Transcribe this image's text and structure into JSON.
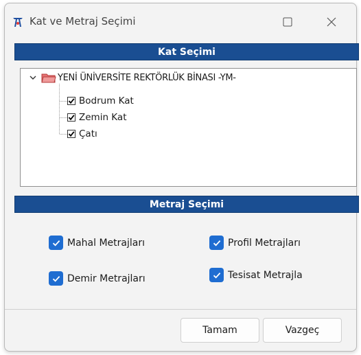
{
  "window": {
    "title": "Kat ve Metraj Seçimi",
    "app_icon": "app-logo-icon",
    "maximize_icon": "maximize-icon",
    "close_icon": "close-icon"
  },
  "kat_section": {
    "header": "Kat Seçimi",
    "tree": {
      "root": {
        "label": "YENİ ÜNİVERSİTE REKTÖRLÜK BİNASI -YM-",
        "expanded": true,
        "icon": "folder-icon"
      },
      "children": [
        {
          "label": "Bodrum Kat",
          "checked": true
        },
        {
          "label": "Zemin Kat",
          "checked": true
        },
        {
          "label": "Çatı",
          "checked": true
        }
      ]
    }
  },
  "metraj_section": {
    "header": "Metraj Seçimi",
    "options": [
      {
        "label": "Mahal Metrajları",
        "checked": true
      },
      {
        "label": "Profil Metrajları",
        "checked": true
      },
      {
        "label": "Demir Metrajları",
        "checked": true
      },
      {
        "label": "Tesisat Metrajla",
        "checked": true
      }
    ]
  },
  "buttons": {
    "ok": "Tamam",
    "cancel": "Vazgeç"
  },
  "colors": {
    "header_bg": "#1a4e92",
    "checkbox_accent": "#1f6dd1",
    "window_bg": "#f3f3f3"
  }
}
